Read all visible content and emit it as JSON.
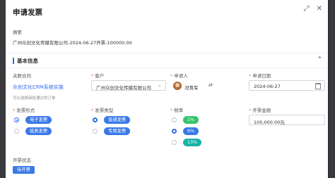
{
  "dialog": {
    "title": "申请发票"
  },
  "summary": {
    "label": "摘要",
    "value": "广州众创文化传媒有限公司-2024-06-27开票-100000.00"
  },
  "section": {
    "title": "基本信息"
  },
  "contract": {
    "label": "关联合同",
    "value": "众创文化CRM系统实施",
    "hint": "可以选择审批通过的订单"
  },
  "customer": {
    "label": "客户",
    "value": "广州众创文化传媒有限公司"
  },
  "applicant": {
    "label": "申请人",
    "name": "况育军"
  },
  "apply_date": {
    "label": "申请日期",
    "value": "2024-06-27"
  },
  "invoice_form": {
    "label": "发票形式",
    "options": [
      "电子发票",
      "纸质发票"
    ],
    "selected": 0
  },
  "invoice_type": {
    "label": "发票类型",
    "options": [
      "普通发票",
      "专用发票"
    ],
    "selected": 0
  },
  "tax_rate": {
    "label": "税率",
    "options": [
      "1%",
      "6%",
      "13%"
    ],
    "selected": 1
  },
  "amount": {
    "label": "开票金额",
    "value": "100,000.00元"
  },
  "status": {
    "label": "开票状态",
    "value": "待开票"
  },
  "icons": {
    "maximize": "maximize-icon",
    "close": "close-icon",
    "collapse": "chevron-up-icon",
    "swap": "swap-icon",
    "calendar": "calendar-icon",
    "dropdown": "chevron-down-icon"
  },
  "colors": {
    "primary": "#2f6ce5",
    "tag_blue": "#3a79e8",
    "tag_green": "#35c46a",
    "tag_teal": "#19b3a6",
    "required": "#f56c6c"
  }
}
